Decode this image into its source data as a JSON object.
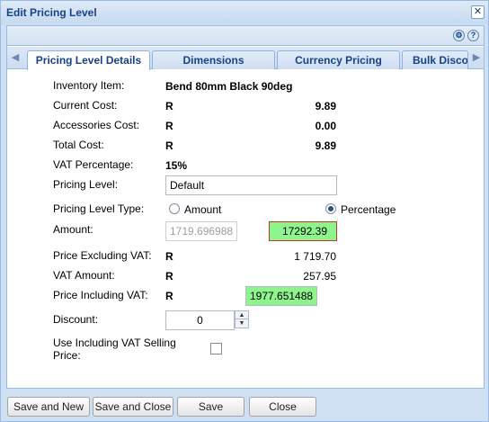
{
  "window": {
    "title": "Edit Pricing Level"
  },
  "icons": {
    "close": "close-icon",
    "settings": "gear-icon",
    "help": "help-icon",
    "left": "arrow-left-icon",
    "right": "arrow-right-icon"
  },
  "tabs": [
    {
      "label": "Pricing Level Details",
      "active": true
    },
    {
      "label": "Dimensions",
      "active": false
    },
    {
      "label": "Currency Pricing",
      "active": false
    },
    {
      "label": "Bulk Discou",
      "active": false
    }
  ],
  "form": {
    "inventory_item": {
      "label": "Inventory Item:",
      "value": "Bend 80mm Black 90deg"
    },
    "current_cost": {
      "label": "Current Cost:",
      "currency": "R",
      "value": "9.89"
    },
    "accessories_cost": {
      "label": "Accessories Cost:",
      "currency": "R",
      "value": "0.00"
    },
    "total_cost": {
      "label": "Total Cost:",
      "currency": "R",
      "value": "9.89"
    },
    "vat_percentage": {
      "label": "VAT Percentage:",
      "value": "15%"
    },
    "pricing_level": {
      "label": "Pricing Level:",
      "value": "Default"
    },
    "pricing_level_type": {
      "label": "Pricing Level Type:",
      "option_amount": "Amount",
      "option_percentage": "Percentage",
      "selected": "Percentage"
    },
    "amount": {
      "label": "Amount:",
      "amount_value": "1719.696988⁠",
      "percentage_value": "17292.39"
    },
    "price_excl_vat": {
      "label": "Price Excluding VAT:",
      "currency": "R",
      "value": "1 719.70"
    },
    "vat_amount": {
      "label": "VAT Amount:",
      "currency": "R",
      "value": "257.95"
    },
    "price_incl_vat": {
      "label": "Price Including VAT:",
      "currency": "R",
      "value": "1977.651488"
    },
    "discount": {
      "label": "Discount:",
      "value": "0"
    },
    "use_incl_vat": {
      "label_line1": "Use Including VAT Selling",
      "label_line2": "Price:",
      "checked": false
    }
  },
  "buttons": {
    "save_and_new": "Save and New",
    "save_and_close": "Save and Close",
    "save": "Save",
    "close": "Close"
  },
  "colors": {
    "highlight_green": "#8ef58c",
    "error_border": "#c0392b",
    "accent": "#15428b"
  }
}
